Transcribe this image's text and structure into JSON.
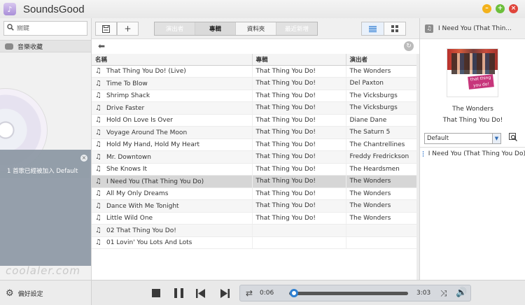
{
  "app": {
    "title": "SoundsGood"
  },
  "window_controls": {
    "minimize": "–",
    "maximize": "+",
    "close": "×"
  },
  "sidebar": {
    "search_placeholder": "關鍵",
    "collection_label": "音樂收藏",
    "notice_text": "1 首歌已經被加入 Default",
    "watermark": "coolaler.com",
    "preferences_label": "偏好設定"
  },
  "toolbar": {
    "tabs": [
      {
        "label": "演出者",
        "state": "dim"
      },
      {
        "label": "專輯",
        "state": "active"
      },
      {
        "label": "資料夾",
        "state": "normal"
      },
      {
        "label": "最近新增",
        "state": "dim"
      }
    ]
  },
  "table": {
    "headers": {
      "title": "名稱",
      "album": "專輯",
      "artist": "演出者"
    },
    "rows": [
      {
        "title": "That Thing You Do! (Live)",
        "album": "That Thing You Do!",
        "artist": "The Wonders"
      },
      {
        "title": "Time To Blow",
        "album": "That Thing You Do!",
        "artist": "Del Paxton"
      },
      {
        "title": "Shrimp Shack",
        "album": "That Thing You Do!",
        "artist": "The Vicksburgs"
      },
      {
        "title": "Drive Faster",
        "album": "That Thing You Do!",
        "artist": "The Vicksburgs"
      },
      {
        "title": "Hold On Love Is Over",
        "album": "That Thing You Do!",
        "artist": "Diane Dane"
      },
      {
        "title": "Voyage Around The Moon",
        "album": "That Thing You Do!",
        "artist": "The Saturn 5"
      },
      {
        "title": "Hold My Hand, Hold My Heart",
        "album": "That Thing You Do!",
        "artist": "The Chantrellines"
      },
      {
        "title": "Mr. Downtown",
        "album": "That Thing You Do!",
        "artist": "Freddy Fredrickson"
      },
      {
        "title": "She Knows It",
        "album": "That Thing You Do!",
        "artist": "The Heardsmen"
      },
      {
        "title": "I Need You (That Thing You Do)",
        "album": "That Thing You Do!",
        "artist": "The Wonders",
        "selected": true
      },
      {
        "title": "All My Only Dreams",
        "album": "That Thing You Do!",
        "artist": "The Wonders"
      },
      {
        "title": "Dance With Me Tonight",
        "album": "That Thing You Do!",
        "artist": "The Wonders"
      },
      {
        "title": "Little Wild One",
        "album": "That Thing You Do!",
        "artist": "The Wonders"
      },
      {
        "title": "02 That Thing You Do!",
        "album": "",
        "artist": ""
      },
      {
        "title": "01 Lovin' You Lots And Lots",
        "album": "",
        "artist": ""
      }
    ]
  },
  "now_playing": {
    "header_title": "I Need You (That Thin...",
    "artist": "The Wonders",
    "album": "That Thing You Do!",
    "cover_text": "that thing you do!",
    "playlist_selected": "Default",
    "playlist_items": [
      "I Need You (That Thing You Do)"
    ]
  },
  "player": {
    "current_time": "0:06",
    "total_time": "3:03",
    "progress_fraction": 0.03
  },
  "colors": {
    "accent": "#2d7fd1",
    "selected_row": "#d6d6d6",
    "notice_bg": "#8f9aa6"
  }
}
